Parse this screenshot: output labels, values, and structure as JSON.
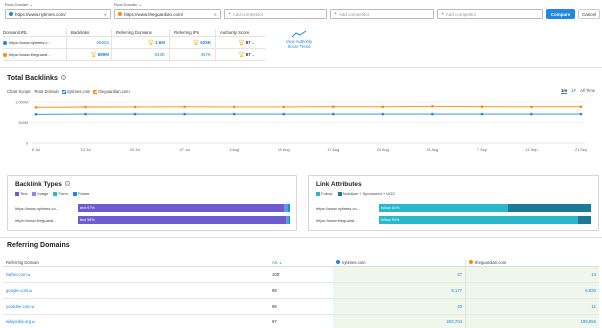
{
  "colors": {
    "blue": "#1e88e5",
    "orange": "#ff8a00",
    "purple": "#6d5bd0",
    "teal": "#2ab7ca",
    "green_bg": "#eef7e9"
  },
  "topbar": {
    "domain1": {
      "label": "Root Domain",
      "value": "https://www.nytimes.com/",
      "clear": "✕"
    },
    "domain2": {
      "label": "Root Domain",
      "value": "https://www.theguardian.com/",
      "clear": "✕"
    },
    "add_placeholder": "Add competitor",
    "compare_label": "Compare",
    "cancel_label": "Cancel"
  },
  "summary": {
    "headers": [
      "Domain/URL",
      "Backlinks",
      "Referring Domains",
      "Referring IPs",
      "Authority Score"
    ],
    "rows": [
      {
        "domain": "https://www.nytimes.c...",
        "backlinks": "69603",
        "ref_domains": "1.6M",
        "ref_ips": "625K",
        "authority": "87"
      },
      {
        "domain": "https://www.theguardi...",
        "backlinks": "889M",
        "ref_domains": "843K",
        "ref_ips": "457K",
        "authority": "87"
      }
    ],
    "trend_link": "View Authority Score Trend"
  },
  "total_backlinks": {
    "title": "Total Backlinks",
    "chart_scope_label": "Chart Scope:",
    "chart_scope_value": "Root Domain",
    "legend": [
      "nytimes.com",
      "theguardian.com"
    ],
    "periods": [
      "1m",
      "1Y",
      "All Time"
    ],
    "active_period": "1m"
  },
  "chart_data": {
    "type": "line",
    "x": [
      "6 Jul",
      "13 Jul",
      "20 Jul",
      "27 Jul",
      "3 Aug",
      "10 Aug",
      "17 Aug",
      "24 Aug",
      "31 Aug",
      "7 Sep",
      "14 Sep",
      "21 Sep"
    ],
    "series": [
      {
        "name": "nytimes.com",
        "color": "#1e88e5",
        "values": [
          700,
          705,
          705,
          705,
          705,
          705,
          705,
          705,
          705,
          705,
          705,
          705
        ]
      },
      {
        "name": "theguardian.com",
        "color": "#ff8a00",
        "values": [
          870,
          878,
          880,
          882,
          880,
          880,
          885,
          882,
          895,
          885,
          882,
          885
        ]
      }
    ],
    "y_ticks": [
      "1 000M",
      "500M",
      "0"
    ],
    "ylim": [
      0,
      1000
    ],
    "grid": true
  },
  "backlink_types": {
    "title": "Backlink Types",
    "legend": [
      "Text",
      "Image",
      "Form",
      "Frame"
    ],
    "rows": [
      {
        "domain": "https://www.nytimes.co...",
        "label": "text 97%",
        "parts": [
          0.97,
          0.01,
          0.01,
          0.01
        ]
      },
      {
        "domain": "https://www.theguardi...",
        "label": "text 98%",
        "parts": [
          0.98,
          0.007,
          0.007,
          0.006
        ]
      }
    ]
  },
  "link_attributes": {
    "title": "Link Attributes",
    "legend": [
      "Follow",
      "Nofollow + Sponsored + UGC"
    ],
    "rows": [
      {
        "domain": "https://www.nytimes.co...",
        "label": "follow 61%",
        "parts": [
          0.61,
          0.39
        ]
      },
      {
        "domain": "https://www.theguardi...",
        "label": "follow 94%",
        "parts": [
          0.94,
          0.06
        ]
      }
    ]
  },
  "referring_domains": {
    "title": "Referring Domains",
    "headers": {
      "domain": "Referring Domain",
      "as": "AS",
      "col1": "nytimes.com",
      "col2": "theguardian.com"
    },
    "rows": [
      {
        "domain": "twitter.com",
        "as": "100",
        "v1": "37",
        "v2": "14"
      },
      {
        "domain": "google.com",
        "as": "99",
        "v1": "9,177",
        "v2": "6,830"
      },
      {
        "domain": "youtube.com",
        "as": "98",
        "v1": "40",
        "v2": "11"
      },
      {
        "domain": "wikipedia.org",
        "as": "97",
        "v1": "203,704",
        "v2": "199,656"
      }
    ]
  }
}
